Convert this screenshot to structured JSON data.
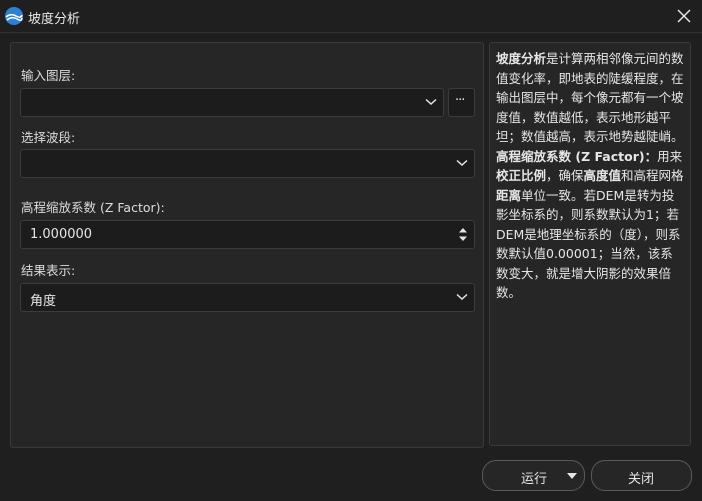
{
  "window": {
    "title": "坡度分析",
    "icon": "app-logo-icon",
    "close_icon": "close-icon"
  },
  "form": {
    "input_layer": {
      "label": "输入图层:",
      "value": "",
      "browse_label": "···"
    },
    "band": {
      "label": "选择波段:",
      "value": ""
    },
    "z_factor": {
      "label": "高程缩放系数 (Z Factor):",
      "value": "1.000000"
    },
    "result": {
      "label": "结果表示:",
      "value": "角度"
    }
  },
  "help": {
    "p1": {
      "term": "坡度分析",
      "text": "是计算两相邻像元间的数值变化率，即地表的陡缓程度，在输出图层中，每个像元都有一个坡度值，数值越低，表示地形越平坦；数值越高，表示地势越陡峭。"
    },
    "p2": {
      "term": "高程缩放系数 (Z Factor)：",
      "t1": "用来",
      "term2": "校正比例",
      "t2": "，确保",
      "term3": "高度值",
      "t3": "和高程网格",
      "term4": "距离",
      "t4": "单位一致。若DEM是转为投影坐标系的，则系数默认为1；若DEM是地理坐标系的（度），则系数默认值0.00001；当然，该系数变大，就是增大阴影的效果倍数。"
    }
  },
  "buttons": {
    "run": "运行",
    "close": "关闭"
  },
  "colors": {
    "background": "#1f1f1f",
    "panel": "#262626",
    "field": "#1c1c1c",
    "border": "#3a3a3a",
    "text": "#e6e6e6",
    "logo": "#2f7fd6"
  }
}
